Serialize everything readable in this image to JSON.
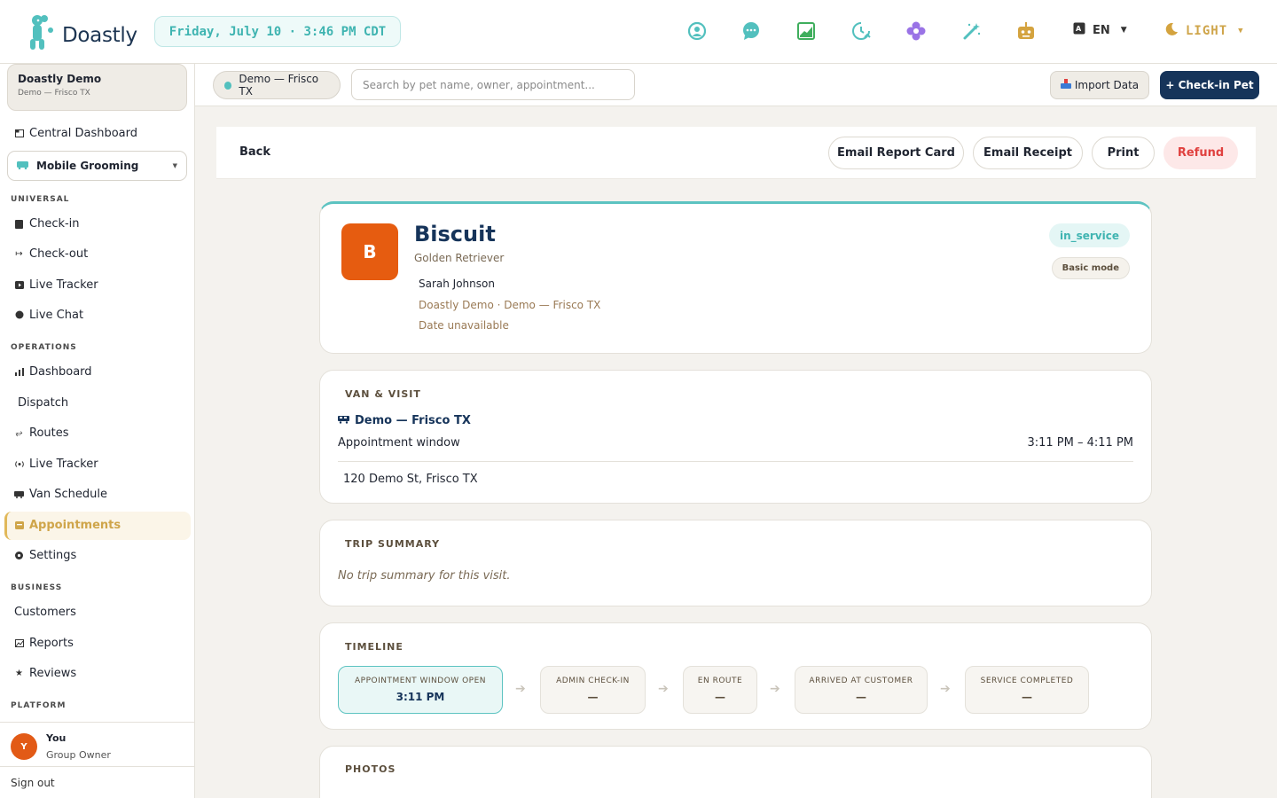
{
  "app": {
    "logo_text": "Doastly",
    "clock": "Friday, July 10 · 3:46 PM CDT"
  },
  "topbar": {
    "icons": [
      "account-icon",
      "chat-icon",
      "chart-icon",
      "clock-icon",
      "flower-icon",
      "magic-wand-icon",
      "robot-icon"
    ],
    "lang": "EN",
    "theme": "LIGHT"
  },
  "sidebar": {
    "org_name": "Doastly Demo",
    "org_sub": "Demo — Frisco TX",
    "central": "Central Dashboard",
    "mode_select": "Mobile Grooming",
    "section_universal": "UNIVERSAL",
    "universal": [
      "Check-in",
      "Check-out",
      "Live Tracker",
      "Live Chat"
    ],
    "section_operations": "OPERATIONS",
    "operations": [
      "Dashboard",
      "Dispatch",
      "Routes",
      "Live Tracker",
      "Van Schedule",
      "Appointments",
      "Settings"
    ],
    "section_business": "BUSINESS",
    "business": [
      "Customers",
      "Reports",
      "Reviews"
    ],
    "section_platform": "PLATFORM",
    "user_initial": "Y",
    "user_name": "You",
    "user_role": "Group Owner",
    "signout": "Sign out"
  },
  "subbar": {
    "location": "Demo — Frisco TX",
    "search_placeholder": "Search by pet name, owner, appointment...",
    "import": "Import Data",
    "checkin": "+ Check-in Pet"
  },
  "actions": {
    "back": "Back",
    "email_report": "Email Report Card",
    "email_receipt": "Email Receipt",
    "print": "Print",
    "refund": "Refund"
  },
  "pet": {
    "initial": "B",
    "name": "Biscuit",
    "breed": "Golden Retriever",
    "owner": "Sarah Johnson",
    "org": "Doastly Demo · Demo — Frisco TX",
    "date": "Date unavailable",
    "status": "in_service",
    "mode": "Basic mode"
  },
  "van_visit": {
    "title": "VAN & VISIT",
    "van": "Demo — Frisco TX",
    "window_label": "Appointment window",
    "window_value": "3:11 PM – 4:11 PM",
    "address": "120 Demo St, Frisco TX"
  },
  "trip": {
    "title": "TRIP SUMMARY",
    "empty": "No trip summary for this visit."
  },
  "timeline": {
    "title": "TIMELINE",
    "steps": [
      {
        "label": "APPOINTMENT WINDOW OPEN",
        "value": "3:11 PM"
      },
      {
        "label": "ADMIN CHECK-IN",
        "value": "—"
      },
      {
        "label": "EN ROUTE",
        "value": "—"
      },
      {
        "label": "ARRIVED AT CUSTOMER",
        "value": "—"
      },
      {
        "label": "SERVICE COMPLETED",
        "value": "—"
      }
    ]
  },
  "photos": {
    "title": "PHOTOS"
  },
  "colors": {
    "accent": "#3fb4b1",
    "navy": "#16345a",
    "gold": "#cfa54a",
    "orange": "#e65c10",
    "danger": "#e0413f"
  }
}
